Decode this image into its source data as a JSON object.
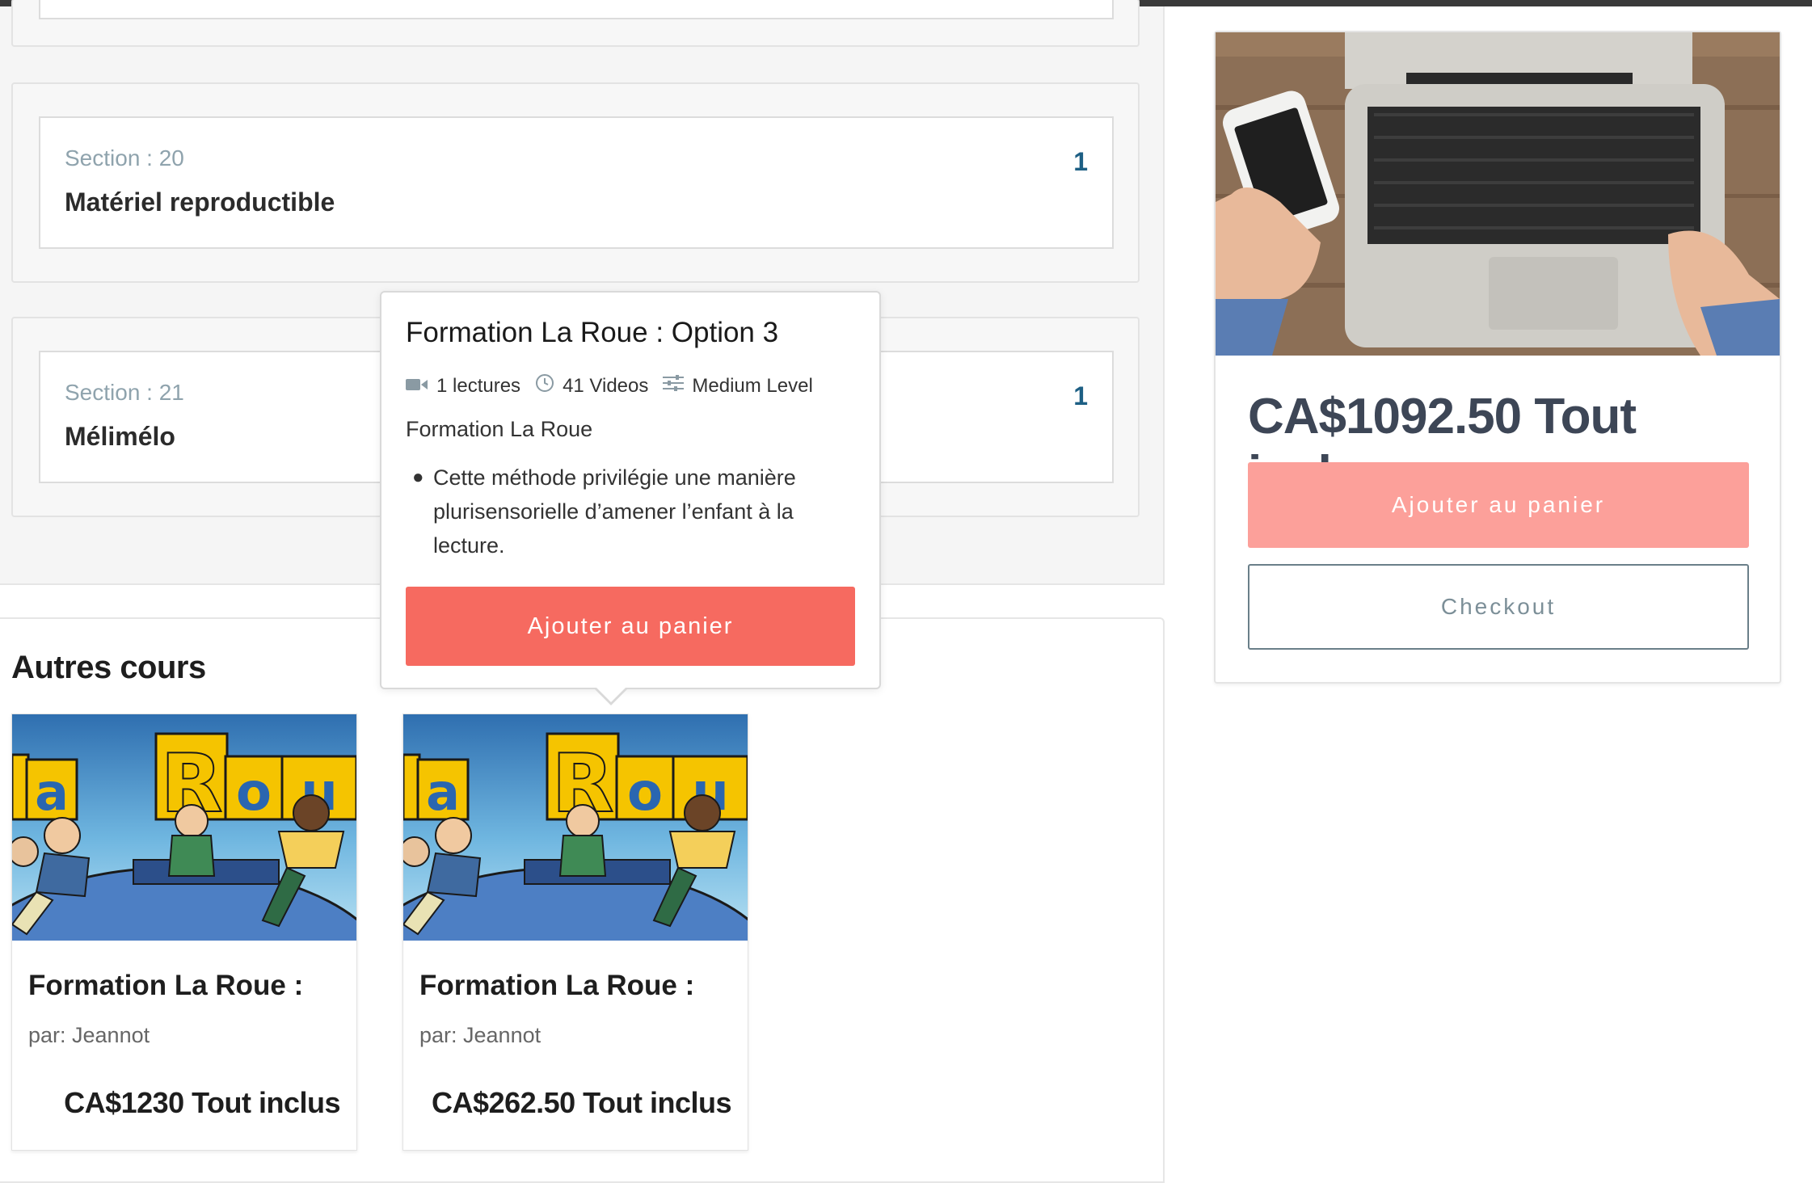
{
  "curriculum": {
    "sections": [
      {
        "number": "Section : 20",
        "title": "Matériel reproductible",
        "count": "1"
      },
      {
        "number": "Section : 21",
        "title": "Mélimélo",
        "count": "1"
      }
    ]
  },
  "popover": {
    "title": "Formation La Roue : Option 3",
    "lectures": "1 lectures",
    "videos": "41 Videos",
    "level": "Medium Level",
    "subtitle": "Formation La Roue",
    "bullet": "Cette méthode privilégie une manière plurisensorielle d’amener l’enfant à la lecture.",
    "button": "Ajouter au panier"
  },
  "others": {
    "heading": "Autres cours",
    "courses": [
      {
        "title": "Formation La Roue :",
        "author": "par: Jeannot",
        "price": "CA$1230 Tout inclus",
        "logo_text": "La Rou"
      },
      {
        "title": "Formation La Roue :",
        "author": "par: Jeannot",
        "price": "CA$262.50 Tout inclus",
        "logo_text": "La Rou"
      }
    ]
  },
  "sidebar": {
    "price": "CA$1092.50 Tout inclus",
    "add_to_cart": "Ajouter au panier",
    "checkout": "Checkout"
  },
  "colors": {
    "primary_button": "#f66a60",
    "light_button": "#fca09a",
    "section_count": "#1d5f84"
  }
}
